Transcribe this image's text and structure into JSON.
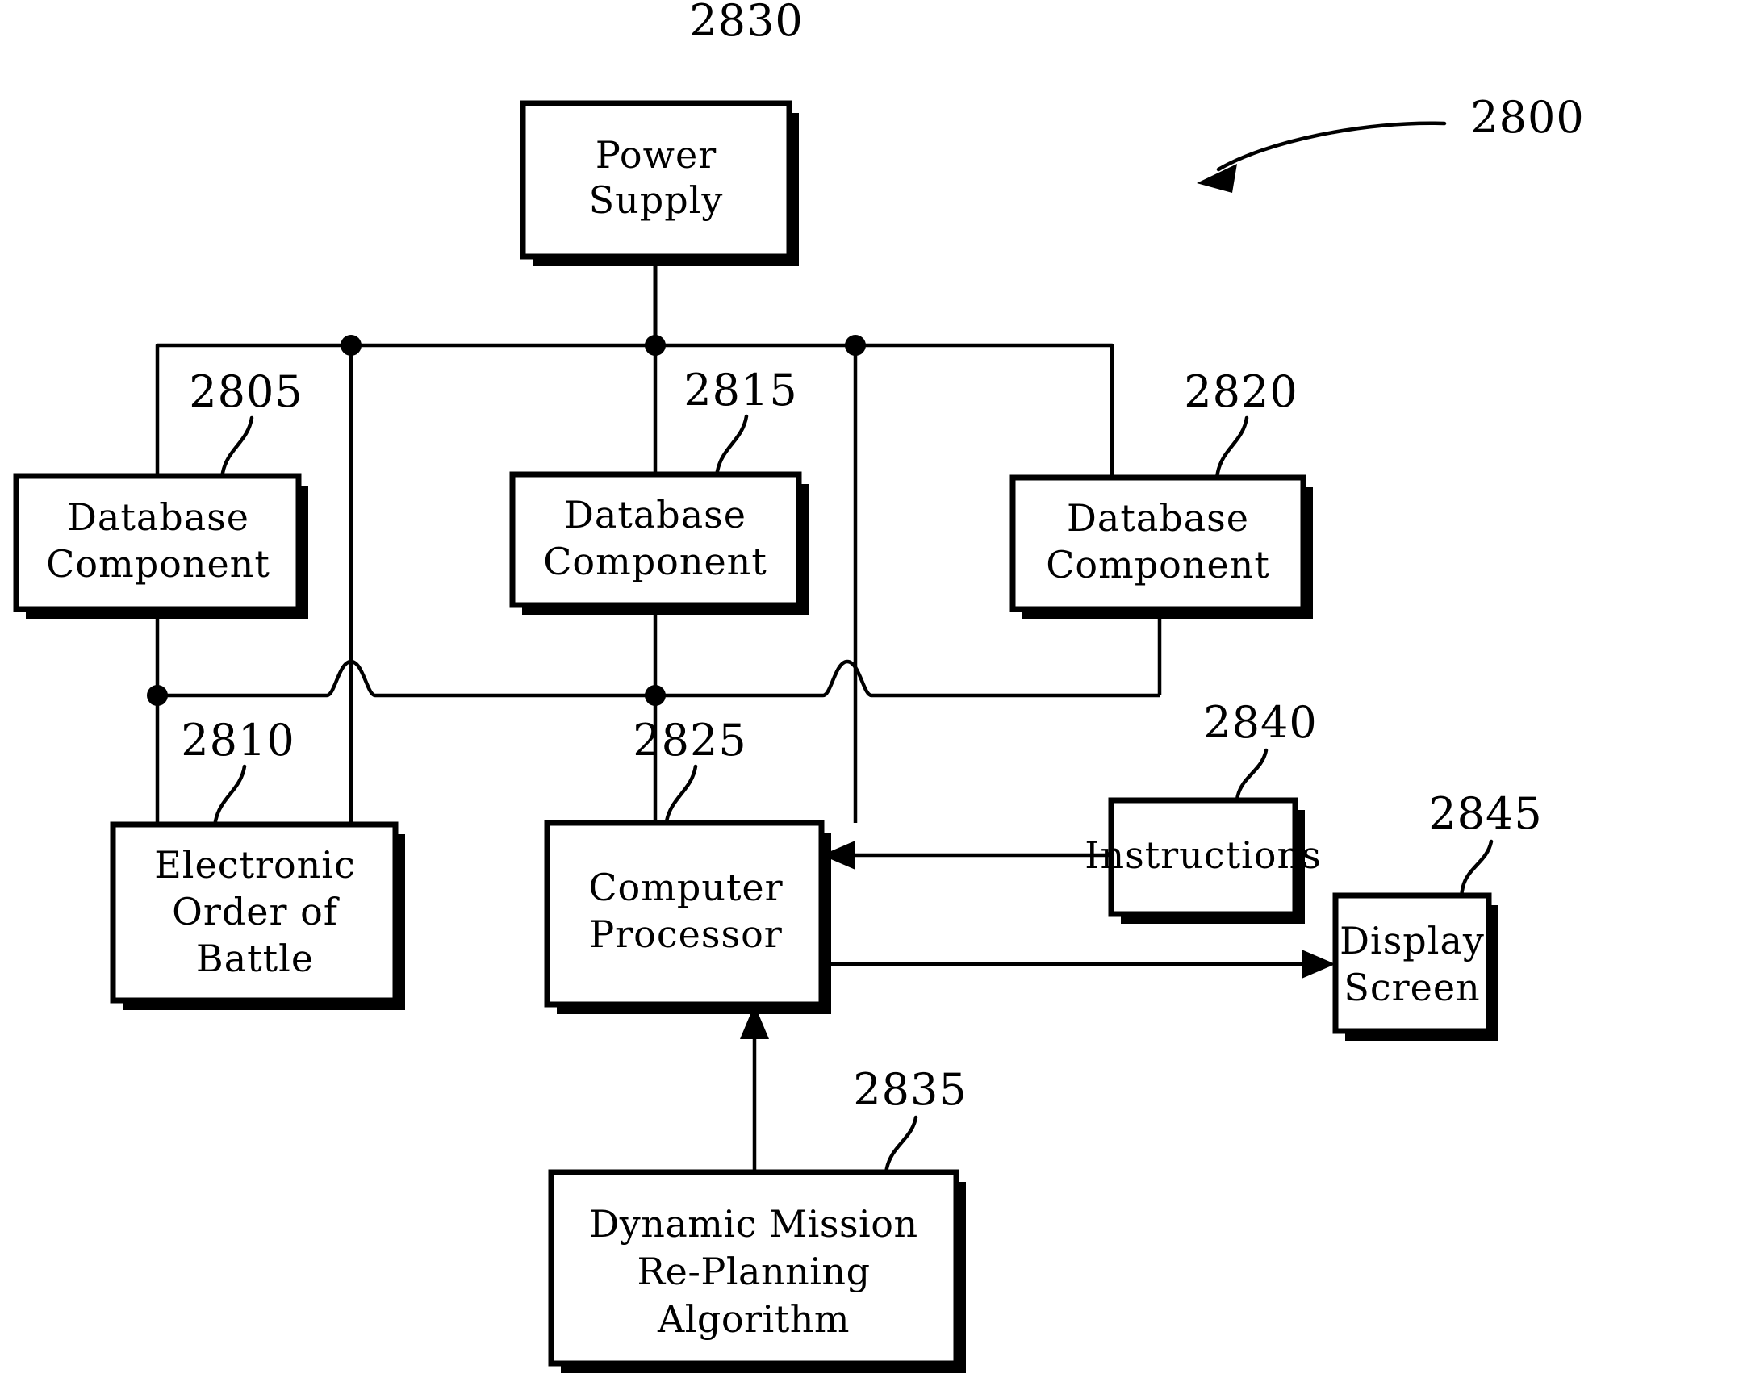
{
  "figure": {
    "name": "figure-2800",
    "overall_ref": "2800",
    "background_color": "#ffffff",
    "line_color": "#000000"
  },
  "boxes": {
    "power_supply": {
      "ref": "2830",
      "lines": [
        "Power",
        "Supply"
      ]
    },
    "database_component_left": {
      "ref": "2805",
      "lines": [
        "Database",
        "Component"
      ]
    },
    "database_component_middle": {
      "ref": "2815",
      "lines": [
        "Database",
        "Component"
      ]
    },
    "database_component_right": {
      "ref": "2820",
      "lines": [
        "Database",
        "Component"
      ]
    },
    "electronic_order_of_battle": {
      "ref": "2810",
      "lines": [
        "Electronic",
        "Order  of",
        "Battle"
      ]
    },
    "computer_processor": {
      "ref": "2825",
      "lines": [
        "Computer",
        "Processor"
      ]
    },
    "instructions": {
      "ref": "2840",
      "lines": [
        "Instructions"
      ]
    },
    "display_screen": {
      "ref": "2845",
      "lines": [
        "Display",
        "Screen"
      ]
    },
    "dynamic_mission_replanning_algorithm": {
      "ref": "2835",
      "lines": [
        "Dynamic  Mission",
        "Re-Planning",
        "Algorithm"
      ]
    }
  }
}
